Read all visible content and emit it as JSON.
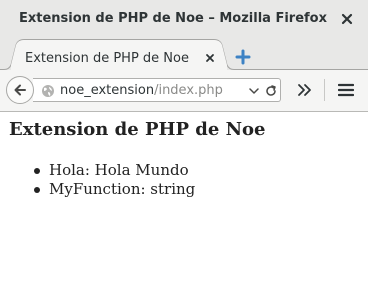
{
  "window": {
    "title": "Extension de PHP de Noe – Mozilla Firefox"
  },
  "tab": {
    "title": "Extension de PHP de Noe"
  },
  "urlbar": {
    "host": "noe_extension",
    "path": "/index.php"
  },
  "page": {
    "heading": "Extension de PHP de Noe",
    "items": [
      {
        "text": "Hola: Hola Mundo"
      },
      {
        "text": "MyFunction: string"
      }
    ]
  },
  "icons": {
    "window_close": "close-icon",
    "tab_close": "close-icon",
    "new_tab": "plus-icon",
    "back": "arrow-left-icon",
    "site": "globe-icon",
    "url_dropdown": "chevron-down-icon",
    "reload": "reload-icon",
    "overflow": "double-chevron-right-icon",
    "menu": "hamburger-menu-icon"
  },
  "colors": {
    "chrome_bg": "#e8e8e7",
    "new_tab_accent": "#3d82c4",
    "text": "#2e3436",
    "url_path": "#8a8a88"
  }
}
